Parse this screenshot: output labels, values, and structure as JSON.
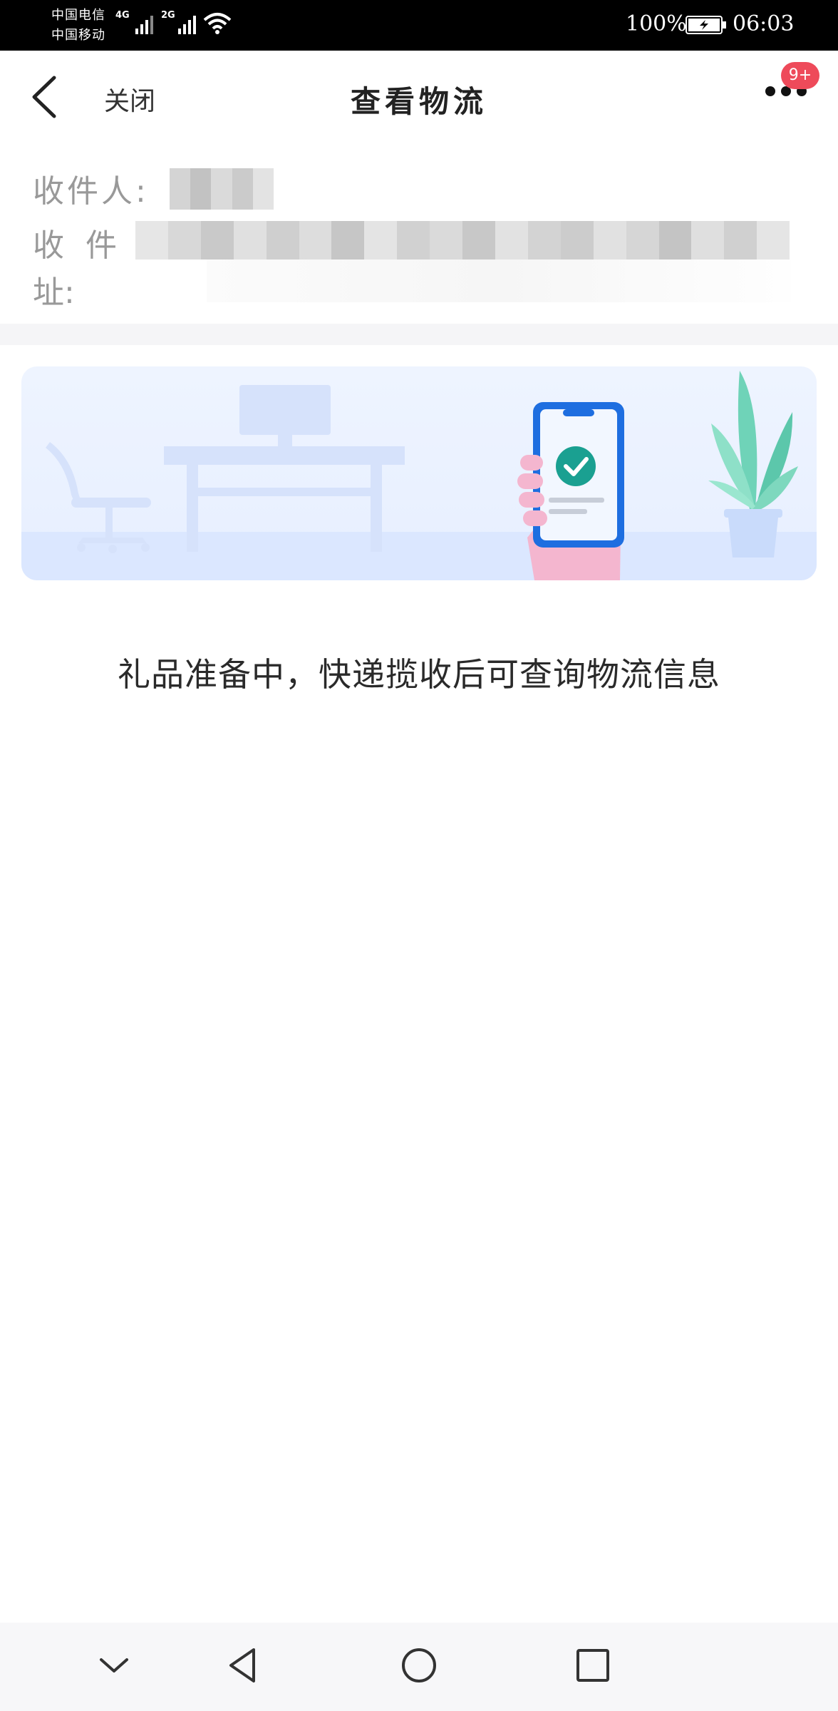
{
  "status_bar": {
    "carrier_1": "中国电信",
    "carrier_2": "中国移动",
    "network_1": "4G",
    "network_2": "2G",
    "battery": "100%",
    "time": "06:03"
  },
  "nav": {
    "close_label": "关闭",
    "title": "查看物流",
    "badge": "9+"
  },
  "address": {
    "recipient_label": "收件人:",
    "address_label_line1": "收件",
    "address_label_line2": "址:"
  },
  "message": "礼品准备中，快递揽收后可查询物流信息",
  "colors": {
    "badge": "#ee4a5a",
    "phone_frame": "#1e6ee0",
    "check": "#1aa091",
    "hand": "#f4b6cf",
    "plant": "#6fd3b8"
  }
}
